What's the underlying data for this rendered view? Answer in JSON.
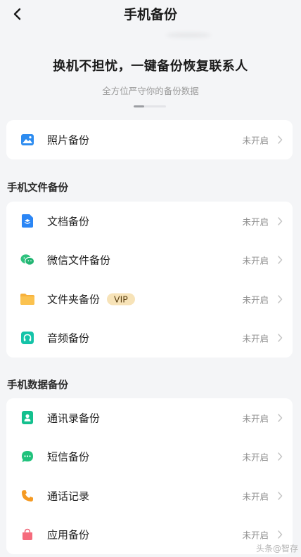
{
  "header": {
    "title": "手机备份"
  },
  "hero": {
    "title": "换机不担忧，一键备份恢复联系人",
    "subtitle": "全方位严守你的备份数据"
  },
  "photo_card": {
    "items": [
      {
        "label": "照片备份",
        "status": "未开启",
        "icon": "image-icon"
      }
    ]
  },
  "file_section": {
    "title": "手机文件备份",
    "items": [
      {
        "label": "文档备份",
        "status": "未开启",
        "icon": "document-icon"
      },
      {
        "label": "微信文件备份",
        "status": "未开启",
        "icon": "wechat-icon"
      },
      {
        "label": "文件夹备份",
        "badge": "VIP",
        "status": "未开启",
        "icon": "folder-icon"
      },
      {
        "label": "音频备份",
        "status": "未开启",
        "icon": "headphones-icon"
      }
    ]
  },
  "data_section": {
    "title": "手机数据备份",
    "items": [
      {
        "label": "通讯录备份",
        "status": "未开启",
        "icon": "contacts-icon"
      },
      {
        "label": "短信备份",
        "status": "未开启",
        "icon": "message-icon"
      },
      {
        "label": "通话记录",
        "status": "未开启",
        "icon": "phone-icon"
      },
      {
        "label": "应用备份",
        "status": "未开启",
        "icon": "app-bag-icon"
      }
    ]
  },
  "watermark": "头条@智存"
}
